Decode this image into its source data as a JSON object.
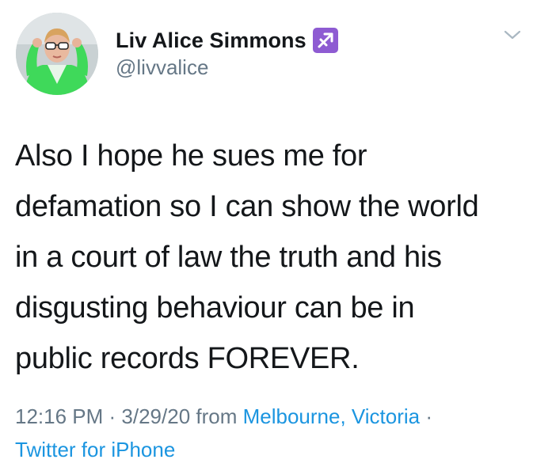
{
  "user": {
    "display_name": "Liv Alice Simmons",
    "handle": "@livvalice",
    "badge_icon": "sagittarius-icon",
    "badge_color": "#8e5bd2"
  },
  "tweet": {
    "text": "Also I hope he sues me for\ndefamation so I can show the world\nin a court of law the truth and his\ndisgusting behaviour can be in\npublic records FOREVER."
  },
  "meta": {
    "time": "12:16 PM",
    "separator": " · ",
    "date": "3/29/20",
    "from_label": " from ",
    "location": "Melbourne, Victoria",
    "separator2": " · ",
    "source": "Twitter for iPhone"
  },
  "colors": {
    "text": "#14171a",
    "muted": "#657786",
    "link": "#1b95e0"
  }
}
